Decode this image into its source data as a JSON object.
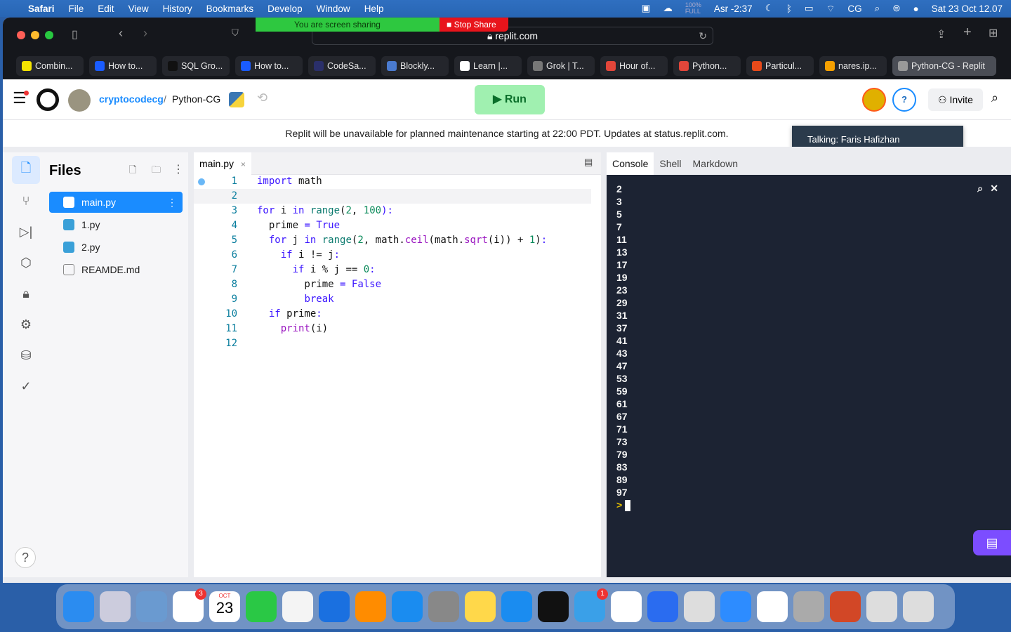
{
  "menubar": {
    "app": "Safari",
    "items": [
      "File",
      "Edit",
      "View",
      "History",
      "Bookmarks",
      "Develop",
      "Window",
      "Help"
    ],
    "battery_pct": "100%",
    "battery_label": "FULL",
    "prayer": "Asr -2:37",
    "user": "CG",
    "datetime": "Sat 23 Oct  12.07"
  },
  "screenshare": {
    "status": "You are screen sharing",
    "stop": "Stop Share"
  },
  "browser": {
    "url": "replit.com",
    "tabs": [
      {
        "label": "Combin...",
        "color": "#f5e400"
      },
      {
        "label": "How to...",
        "color": "#1a5cff"
      },
      {
        "label": "SQL Gro...",
        "color": "#111"
      },
      {
        "label": "How to...",
        "color": "#1a5cff"
      },
      {
        "label": "CodeSa...",
        "color": "#2a2f6a"
      },
      {
        "label": "Blockly...",
        "color": "#4a7bd0"
      },
      {
        "label": "Learn |...",
        "color": "#fff"
      },
      {
        "label": "Grok | T...",
        "color": "#777"
      },
      {
        "label": "Hour of...",
        "color": "#e2463a"
      },
      {
        "label": "Python...",
        "color": "#e2463a"
      },
      {
        "label": "Particul...",
        "color": "#e84a1a"
      },
      {
        "label": "nares.ip...",
        "color": "#f5a000"
      },
      {
        "label": "Python-CG - Replit",
        "color": "#999",
        "active": true
      }
    ]
  },
  "header": {
    "user": "cryptocodecg",
    "sep": "/",
    "repl": "Python-CG",
    "run": "Run",
    "invite": "Invite"
  },
  "banner": "Replit will be unavailable for planned maintenance starting at 22:00 PDT. Updates at status.replit.com.",
  "talking": "Talking: Faris Hafizhan",
  "files": {
    "title": "Files",
    "items": [
      {
        "name": "main.py",
        "type": "python",
        "selected": true
      },
      {
        "name": "1.py",
        "type": "python"
      },
      {
        "name": "2.py",
        "type": "python"
      },
      {
        "name": "REAMDE.md",
        "type": "markdown"
      }
    ]
  },
  "editor": {
    "tab": "main.py",
    "close": "×",
    "lines": [
      [
        [
          "import",
          "kw"
        ],
        [
          " math",
          "id"
        ]
      ],
      [],
      [
        [
          "for",
          "kw"
        ],
        [
          " i ",
          "id"
        ],
        [
          "in",
          "kw"
        ],
        [
          " ",
          "id"
        ],
        [
          "range",
          "fn"
        ],
        [
          "(",
          "id"
        ],
        [
          "2",
          "num"
        ],
        [
          ", ",
          "id"
        ],
        [
          "100",
          "num"
        ],
        [
          "):",
          "kw"
        ]
      ],
      [
        [
          "  prime ",
          "id"
        ],
        [
          "=",
          "kw"
        ],
        [
          " ",
          "id"
        ],
        [
          "True",
          "kw"
        ]
      ],
      [
        [
          "  ",
          "id"
        ],
        [
          "for",
          "kw"
        ],
        [
          " j ",
          "id"
        ],
        [
          "in",
          "kw"
        ],
        [
          " ",
          "id"
        ],
        [
          "range",
          "fn"
        ],
        [
          "(",
          "id"
        ],
        [
          "2",
          "num"
        ],
        [
          ", math.",
          "id"
        ],
        [
          "ceil",
          "pf"
        ],
        [
          "(math.",
          "id"
        ],
        [
          "sqrt",
          "pf"
        ],
        [
          "(i)) + ",
          "id"
        ],
        [
          "1",
          "num"
        ],
        [
          ")",
          "id"
        ],
        [
          ":",
          "kw"
        ]
      ],
      [
        [
          "    ",
          "id"
        ],
        [
          "if",
          "kw"
        ],
        [
          " i != j",
          "id"
        ],
        [
          ":",
          "kw"
        ]
      ],
      [
        [
          "      ",
          "id"
        ],
        [
          "if",
          "kw"
        ],
        [
          " i % j == ",
          "id"
        ],
        [
          "0",
          "num"
        ],
        [
          ":",
          "kw"
        ]
      ],
      [
        [
          "        prime ",
          "id"
        ],
        [
          "=",
          "kw"
        ],
        [
          " ",
          "id"
        ],
        [
          "False",
          "kw"
        ]
      ],
      [
        [
          "        ",
          "id"
        ],
        [
          "break",
          "kw"
        ]
      ],
      [
        [
          "  ",
          "id"
        ],
        [
          "if",
          "kw"
        ],
        [
          " prime",
          "id"
        ],
        [
          ":",
          "kw"
        ]
      ],
      [
        [
          "    ",
          "id"
        ],
        [
          "print",
          "pf"
        ],
        [
          "(i)",
          "id"
        ]
      ],
      []
    ]
  },
  "console": {
    "tabs": [
      "Console",
      "Shell",
      "Markdown"
    ],
    "active": "Console",
    "output": [
      "2",
      "3",
      "5",
      "7",
      "11",
      "13",
      "17",
      "19",
      "23",
      "29",
      "31",
      "37",
      "41",
      "43",
      "47",
      "53",
      "59",
      "61",
      "67",
      "71",
      "73",
      "79",
      "83",
      "89",
      "97"
    ],
    "prompt": ">"
  },
  "help": "?",
  "colors": {
    "run_bg": "#a0f0b0",
    "run_fg": "#0a6e2a",
    "accent": "#1a8cff",
    "console_bg": "#1c2333",
    "chat": "#7c4dff"
  },
  "dock": [
    "finder",
    "launchpad",
    "preview",
    "reminders",
    "calendar",
    "messages",
    "photos",
    "keynote",
    "books",
    "app-store",
    "system-preferences",
    "notes",
    "safari",
    "terminal",
    "cyberduck",
    "chrome",
    "signal",
    "scanner",
    "zoom",
    "python-idle",
    "rocket",
    "powerpoint",
    "window-manager",
    "trash"
  ],
  "dock_badges": {
    "reminders": "3",
    "cyberduck": "1"
  },
  "calendar": {
    "month": "OCT",
    "day": "23"
  }
}
